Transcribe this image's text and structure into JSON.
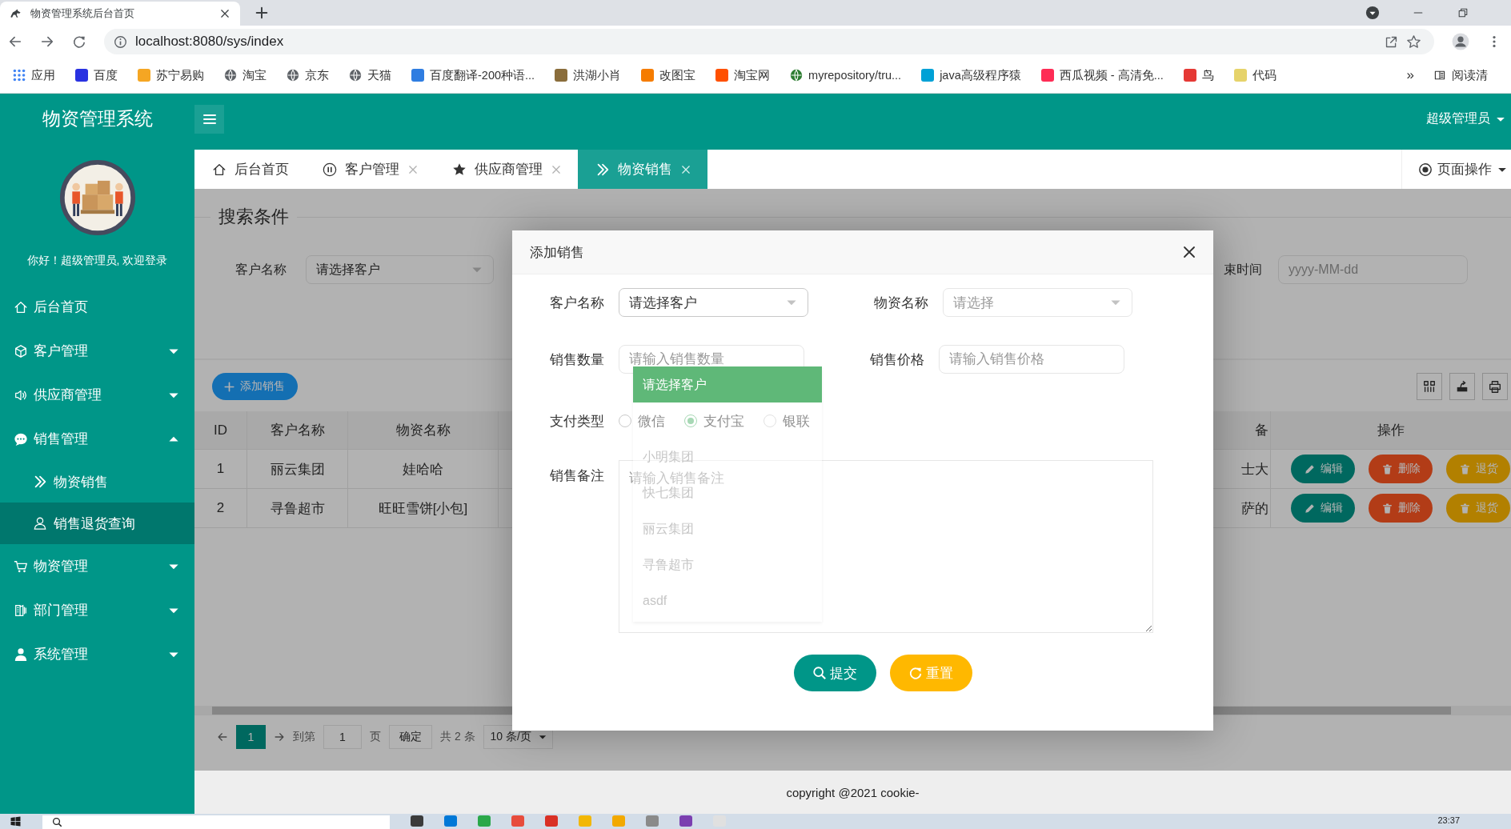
{
  "browser": {
    "tab_title": "物资管理系统后台首页",
    "url": "localhost:8080/sys/index",
    "bookmarks": [
      {
        "label": "应用",
        "kind": "apps",
        "color": "#4285f4"
      },
      {
        "label": "百度",
        "kind": "site",
        "color": "#2932e1"
      },
      {
        "label": "苏宁易购",
        "kind": "site",
        "color": "#f5a623"
      },
      {
        "label": "淘宝",
        "kind": "globe",
        "color": "#5f6368"
      },
      {
        "label": "京东",
        "kind": "globe",
        "color": "#5f6368"
      },
      {
        "label": "天猫",
        "kind": "globe",
        "color": "#5f6368"
      },
      {
        "label": "百度翻译-200种语...",
        "kind": "site",
        "color": "#2f7de1"
      },
      {
        "label": "洪湖小肖",
        "kind": "site",
        "color": "#8a6d3b"
      },
      {
        "label": "改图宝",
        "kind": "site",
        "color": "#f57c00"
      },
      {
        "label": "淘宝网",
        "kind": "site",
        "color": "#ff5000"
      },
      {
        "label": "myrepository/tru...",
        "kind": "globe",
        "color": "#2e7d32"
      },
      {
        "label": "java高级程序猿",
        "kind": "site",
        "color": "#00a1d6"
      },
      {
        "label": "西瓜视频 - 高清免...",
        "kind": "site",
        "color": "#fe2c55"
      },
      {
        "label": "鸟",
        "kind": "site",
        "color": "#e53935"
      },
      {
        "label": "代码",
        "kind": "site",
        "color": "#e6d36a"
      }
    ],
    "more": "»",
    "reading_list": "阅读清"
  },
  "app": {
    "brand": "物资管理系统",
    "user": "超级管理员",
    "greeting": "你好！超级管理员, 欢迎登录"
  },
  "sidebar": [
    {
      "label": "后台首页",
      "kind": "link",
      "selected": false
    },
    {
      "label": "客户管理",
      "kind": "group",
      "expanded": false,
      "selected": false
    },
    {
      "label": "供应商管理",
      "kind": "group",
      "expanded": false,
      "selected": false
    },
    {
      "label": "销售管理",
      "kind": "group",
      "expanded": true,
      "selected": false,
      "children": [
        {
          "label": "物资销售",
          "selected": false
        },
        {
          "label": "销售退货查询",
          "selected": true
        }
      ]
    },
    {
      "label": "物资管理",
      "kind": "group",
      "expanded": false,
      "selected": false
    },
    {
      "label": "部门管理",
      "kind": "group",
      "expanded": false,
      "selected": false
    },
    {
      "label": "系统管理",
      "kind": "group",
      "expanded": false,
      "selected": false
    }
  ],
  "tabs": [
    {
      "label": "后台首页",
      "closable": false,
      "selected": false
    },
    {
      "label": "客户管理",
      "closable": true,
      "selected": false
    },
    {
      "label": "供应商管理",
      "closable": true,
      "selected": false
    },
    {
      "label": "物资销售",
      "closable": true,
      "selected": true
    }
  ],
  "page_ops": "页面操作",
  "search": {
    "legend": "搜索条件",
    "customer_label": "客户名称",
    "customer_value": "请选择客户",
    "end_label": "束时间",
    "end_placeholder": "yyyy-MM-dd"
  },
  "table": {
    "add_button": "添加销售",
    "columns": [
      "ID",
      "客户名称",
      "物资名称"
    ],
    "cut_column": "备",
    "action_column": "操作",
    "rows": [
      {
        "cells": [
          "1",
          "丽云集团",
          "娃哈哈"
        ],
        "cut_cell": "士大",
        "actions": [
          {
            "label": "编辑",
            "kind": "edit"
          },
          {
            "label": "删除",
            "kind": "delete"
          },
          {
            "label": "退货",
            "kind": "return"
          }
        ]
      },
      {
        "cells": [
          "2",
          "寻鲁超市",
          "旺旺雪饼[小包]"
        ],
        "cut_cell": "萨的",
        "actions": [
          {
            "label": "编辑",
            "kind": "edit"
          },
          {
            "label": "删除",
            "kind": "delete"
          },
          {
            "label": "退货",
            "kind": "return"
          }
        ]
      }
    ]
  },
  "pager": {
    "pages": [
      {
        "label": "1",
        "selected": true
      }
    ],
    "goto_label": "到第",
    "goto_value": "1",
    "page_unit": "页",
    "confirm": "确定",
    "total": "共 2 条",
    "page_size": "10 条/页"
  },
  "footer": "copyright @2021 cookie-",
  "modal": {
    "title": "添加销售",
    "rows": [
      [
        {
          "kind": "select",
          "label": "客户名称",
          "value": "请选择客户"
        },
        {
          "kind": "select",
          "label": "物资名称",
          "placeholder": "请选择"
        }
      ],
      [
        {
          "kind": "input",
          "label": "销售数量",
          "placeholder": "请输入销售数量"
        },
        {
          "kind": "input",
          "label": "销售价格",
          "placeholder": "请输入销售价格"
        }
      ],
      [
        {
          "kind": "radio",
          "label": "支付类型",
          "options": [
            {
              "label": "微信",
              "selected": false
            },
            {
              "label": "支付宝",
              "selected": true
            },
            {
              "label": "银联",
              "selected": false
            }
          ]
        }
      ],
      [
        {
          "kind": "textarea",
          "label": "销售备注",
          "placeholder": "请输入销售备注"
        }
      ]
    ],
    "dropdown": [
      {
        "label": "请选择客户",
        "selected": true
      },
      {
        "label": "小明集团",
        "selected": false
      },
      {
        "label": "快七集团",
        "selected": false
      },
      {
        "label": "丽云集团",
        "selected": false
      },
      {
        "label": "寻鲁超市",
        "selected": false
      },
      {
        "label": "asdf",
        "selected": false
      }
    ],
    "buttons": [
      {
        "label": "提交",
        "kind": "submit"
      },
      {
        "label": "重置",
        "kind": "reset"
      }
    ]
  },
  "taskbar": {
    "clock": "23:37"
  }
}
